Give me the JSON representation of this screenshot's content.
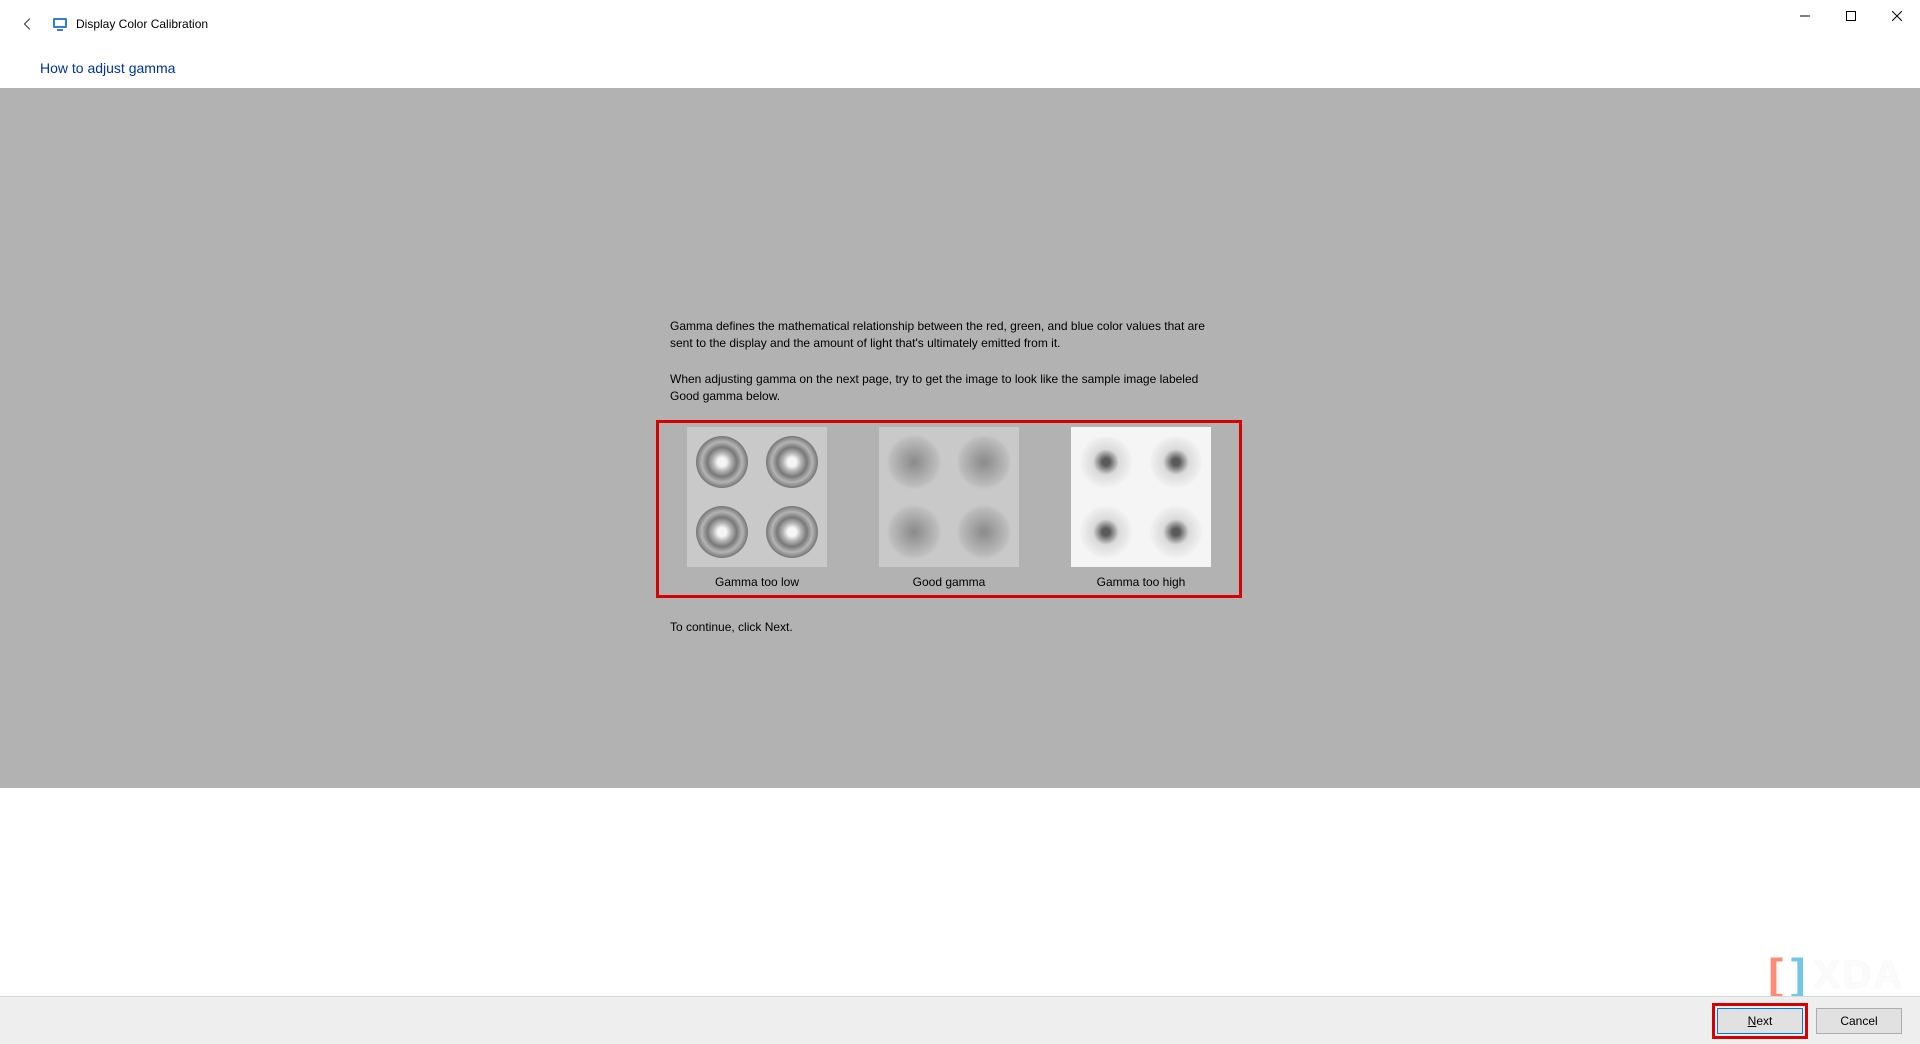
{
  "window": {
    "title": "Display Color Calibration",
    "subtitle": "How to adjust gamma"
  },
  "content": {
    "para1": "Gamma defines the mathematical relationship between the red, green, and blue color values that are sent to the display and the amount of light that's ultimately emitted from it.",
    "para2": "When adjusting gamma on the next page, try to get the image to look like the sample image labeled Good gamma below.",
    "continue": "To continue, click Next."
  },
  "samples": {
    "low": "Gamma too low",
    "good": "Good gamma",
    "high": "Gamma too high"
  },
  "buttons": {
    "next": "Next",
    "cancel": "Cancel"
  },
  "watermark": {
    "text": "XDA"
  }
}
